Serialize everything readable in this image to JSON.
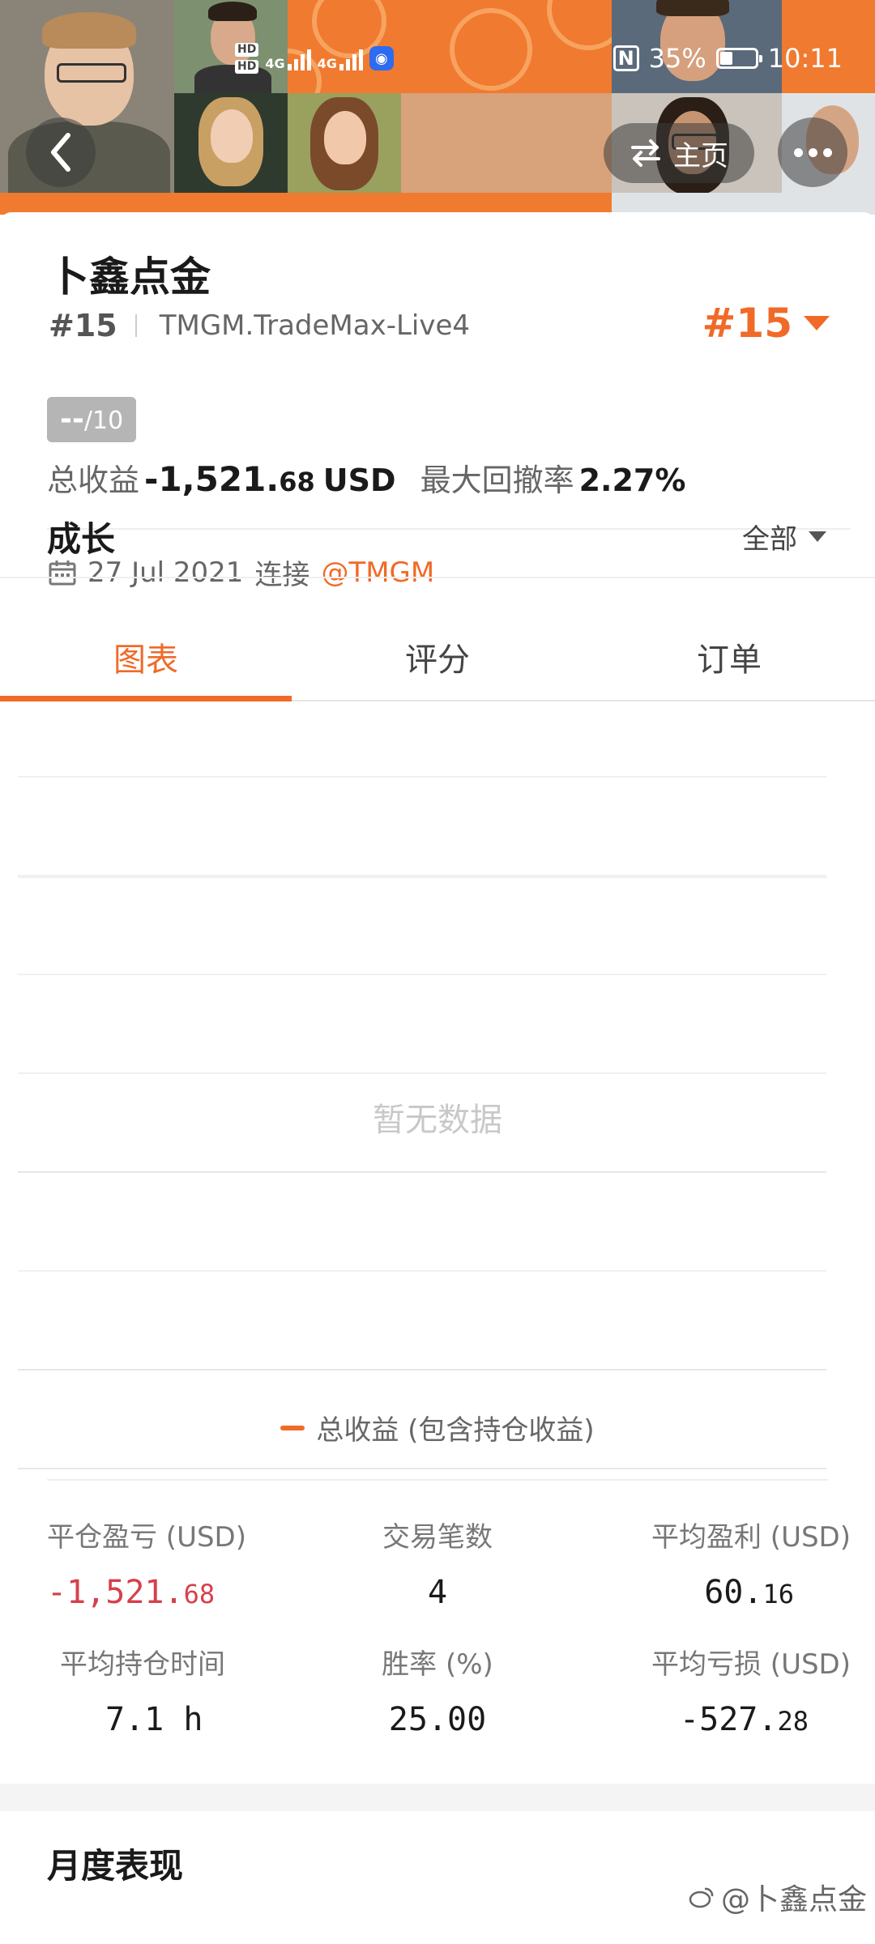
{
  "status_bar": {
    "time": "10:11",
    "battery": "35%",
    "network": "4G",
    "battery_level": 0.35
  },
  "header": {
    "home_label": "主页"
  },
  "profile": {
    "name": "卜鑫点金",
    "rank": "#15",
    "server": "TMGM.TradeMax-Live4",
    "rank_big": "#15",
    "score": "--",
    "score_max": "/10",
    "total_profit_label": "总收益",
    "total_profit_int": "-1,521.",
    "total_profit_dec": "68",
    "total_profit_unit": "USD",
    "max_drawdown_label": "最大回撤率",
    "max_drawdown": "2.27%",
    "joined_date": "27 Jul 2021",
    "joined_text": "连接",
    "broker_handle": "@TMGM"
  },
  "tabs": [
    {
      "label": "图表",
      "active": true
    },
    {
      "label": "评分",
      "active": false
    },
    {
      "label": "订单",
      "active": false
    }
  ],
  "growth": {
    "title": "成长",
    "filter": "全部",
    "empty_text": "暂无数据",
    "legend": "总收益 (包含持仓收益)"
  },
  "stats": [
    {
      "label": "平仓盈亏 (USD)",
      "int": "-1,521.",
      "dec": "68",
      "negative": true
    },
    {
      "label": "交易笔数",
      "int": "4",
      "dec": ""
    },
    {
      "label": "平均盈利 (USD)",
      "int": "60.",
      "dec": "16"
    },
    {
      "label": "平均持仓时间",
      "int": "7.1 h",
      "dec": ""
    },
    {
      "label": "胜率 (%)",
      "int": "25.00",
      "dec": ""
    },
    {
      "label": "平均亏损 (USD)",
      "int": "-527.",
      "dec": "28"
    }
  ],
  "monthly": {
    "title": "月度表现"
  },
  "watermark": "@卜鑫点金",
  "colors": {
    "accent": "#f06a28",
    "negative": "#d6404b",
    "header_bg": "#f07a2f"
  }
}
